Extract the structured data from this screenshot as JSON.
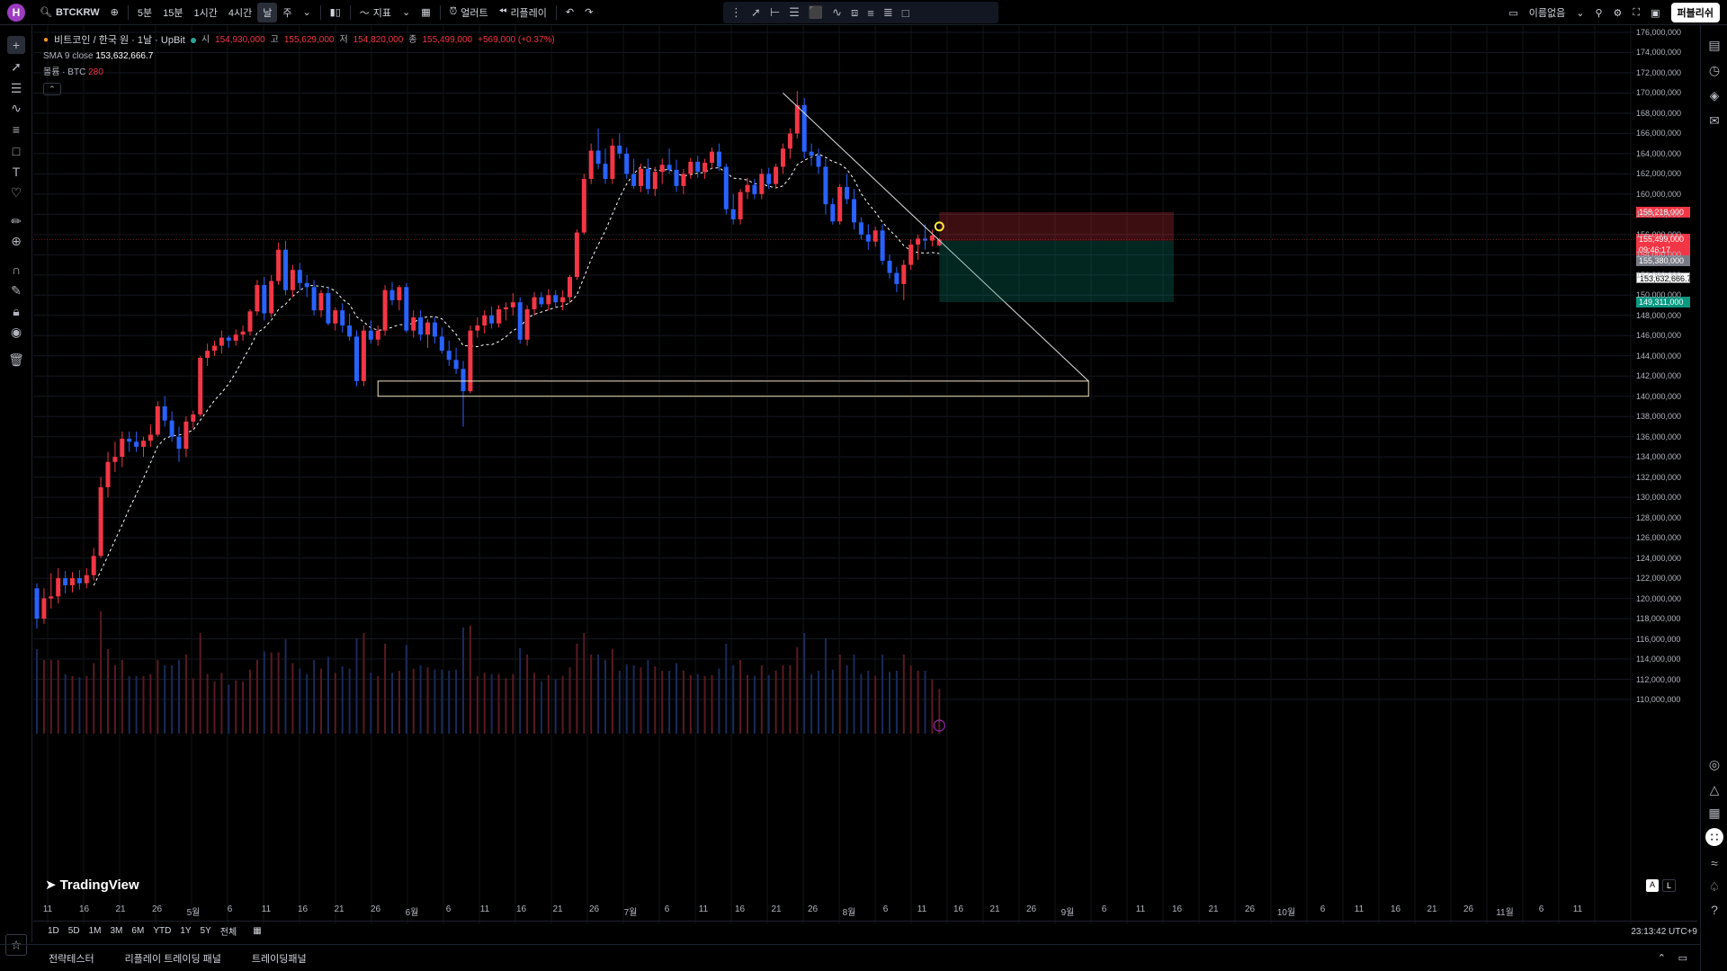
{
  "header": {
    "logo_letter": "H",
    "symbol": "BTCKRW",
    "intervals": [
      "5분",
      "15분",
      "1시간",
      "4시간",
      "날",
      "주"
    ],
    "active_interval": "날",
    "indicators_label": "지표",
    "alert_label": "얼러트",
    "replay_label": "리플레이",
    "layout_name": "이름없음",
    "publish_label": "퍼블리쉬"
  },
  "legend": {
    "title": "비트코인 / 한국 원 · 1날 · UpBit",
    "open_label": "시",
    "open": "154,930,000",
    "high_label": "고",
    "high": "155,629,000",
    "low_label": "저",
    "low": "154,820,000",
    "close_label": "종",
    "close": "155,499,000",
    "change": "+569,000 (+0.37%)",
    "sma_label": "SMA 9 close",
    "sma_value": "153,632,666.7",
    "volume_label": "볼륨 · BTC",
    "volume_value": "280"
  },
  "price_axis": {
    "ticks": [
      "176,000,000",
      "174,000,000",
      "172,000,000",
      "170,000,000",
      "168,000,000",
      "166,000,000",
      "164,000,000",
      "162,000,000",
      "160,000,000",
      "158,000,000",
      "156,000,000",
      "154,000,000",
      "152,000,000",
      "150,000,000",
      "148,000,000",
      "146,000,000",
      "144,000,000",
      "142,000,000",
      "140,000,000",
      "138,000,000",
      "136,000,000",
      "134,000,000",
      "132,000,000",
      "130,000,000",
      "128,000,000",
      "126,000,000",
      "124,000,000",
      "122,000,000",
      "120,000,000",
      "118,000,000",
      "116,000,000",
      "114,000,000",
      "112,000,000",
      "110,000,000"
    ],
    "labels": {
      "stop": "158,218,000",
      "last": "155,499,000",
      "countdown": "09:46:17",
      "entry": "155,380,000",
      "sma": "153,632,666.7",
      "target": "149,311,000"
    }
  },
  "time_axis": {
    "labels": [
      "11",
      "16",
      "21",
      "26",
      "5월",
      "6",
      "11",
      "16",
      "21",
      "26",
      "6월",
      "6",
      "11",
      "16",
      "21",
      "26",
      "7월",
      "6",
      "11",
      "16",
      "21",
      "26",
      "8월",
      "6",
      "11",
      "16",
      "21",
      "26",
      "9월",
      "6",
      "11",
      "16",
      "21",
      "26",
      "10월",
      "6",
      "11",
      "16",
      "21",
      "26",
      "11월",
      "6",
      "11"
    ]
  },
  "range_bar": {
    "ranges": [
      "1D",
      "5D",
      "1M",
      "3M",
      "6M",
      "YTD",
      "1Y",
      "5Y",
      "전체"
    ],
    "clock": "23:13:42 UTC+9"
  },
  "bottom_panel": {
    "tabs": [
      "전략테스터",
      "리플레이 트레이딩 패널",
      "트레이딩패널"
    ]
  },
  "watermark": "TradingView",
  "scale_buttons": [
    "A",
    "L"
  ],
  "colors": {
    "up": "#f23645",
    "down": "#2962ff",
    "sma": "#ffffff",
    "stop_zone": "rgba(242,54,69,0.25)",
    "target_zone": "rgba(8,153,129,0.25)"
  },
  "chart_data": {
    "type": "candlestick",
    "interval": "1D",
    "price_range": [
      109000000,
      177000000
    ],
    "candles_ohlc": [
      [
        121000000,
        121500000,
        117000000,
        118000000
      ],
      [
        118000000,
        121000000,
        117500000,
        120000000
      ],
      [
        120000000,
        122500000,
        119000000,
        120200000
      ],
      [
        120200000,
        123000000,
        119500000,
        122000000
      ],
      [
        122000000,
        122700000,
        120500000,
        121300000
      ],
      [
        121300000,
        122600000,
        120600000,
        122000000
      ],
      [
        122000000,
        122800000,
        120900000,
        121500000
      ],
      [
        121500000,
        123000000,
        121000000,
        122300000
      ],
      [
        122300000,
        125000000,
        121800000,
        124200000
      ],
      [
        124200000,
        132000000,
        124000000,
        131000000
      ],
      [
        131000000,
        134500000,
        130000000,
        133500000
      ],
      [
        133500000,
        135500000,
        132500000,
        134000000
      ],
      [
        134000000,
        136500000,
        133000000,
        135800000
      ],
      [
        135800000,
        136500000,
        134500000,
        135500000
      ],
      [
        135500000,
        136500000,
        134500000,
        135000000
      ],
      [
        135000000,
        136000000,
        134000000,
        135600000
      ],
      [
        135600000,
        137200000,
        135000000,
        136200000
      ],
      [
        136200000,
        139500000,
        136000000,
        139000000
      ],
      [
        139000000,
        140000000,
        137000000,
        137600000
      ],
      [
        137600000,
        138500000,
        135500000,
        136000000
      ],
      [
        136000000,
        137000000,
        133500000,
        134800000
      ],
      [
        134800000,
        138000000,
        134000000,
        137500000
      ],
      [
        137500000,
        138600000,
        136800000,
        138200000
      ],
      [
        138200000,
        144000000,
        138000000,
        143800000
      ],
      [
        143800000,
        145200000,
        143000000,
        144500000
      ],
      [
        144500000,
        145500000,
        144000000,
        145000000
      ],
      [
        145000000,
        146500000,
        144200000,
        145800000
      ],
      [
        145800000,
        146000000,
        144800000,
        145500000
      ],
      [
        145500000,
        146600000,
        145000000,
        146100000
      ],
      [
        146100000,
        147000000,
        145500000,
        146400000
      ],
      [
        146400000,
        148600000,
        146000000,
        148400000
      ],
      [
        148400000,
        151500000,
        148000000,
        151000000
      ],
      [
        151000000,
        151800000,
        147500000,
        148200000
      ],
      [
        148200000,
        152000000,
        147800000,
        151400000
      ],
      [
        151400000,
        155200000,
        151000000,
        154500000
      ],
      [
        154500000,
        155400000,
        150000000,
        150500000
      ],
      [
        150500000,
        153000000,
        149800000,
        152500000
      ],
      [
        152500000,
        153200000,
        150500000,
        151200000
      ],
      [
        151200000,
        152000000,
        149800000,
        150800000
      ],
      [
        150800000,
        151500000,
        148000000,
        148500000
      ],
      [
        148500000,
        150500000,
        147800000,
        150200000
      ],
      [
        150200000,
        150800000,
        147000000,
        147200000
      ],
      [
        147200000,
        148800000,
        146500000,
        148500000
      ],
      [
        148500000,
        149200000,
        146300000,
        147000000
      ],
      [
        147000000,
        148200000,
        145500000,
        145900000
      ],
      [
        145900000,
        146500000,
        141000000,
        141500000
      ],
      [
        141500000,
        147000000,
        141000000,
        146500000
      ],
      [
        146500000,
        147500000,
        145200000,
        145600000
      ],
      [
        145600000,
        147000000,
        145000000,
        146500000
      ],
      [
        146500000,
        151000000,
        146000000,
        150500000
      ],
      [
        150500000,
        151300000,
        149000000,
        149500000
      ],
      [
        149500000,
        151000000,
        148500000,
        150800000
      ],
      [
        150800000,
        151200000,
        146300000,
        146500000
      ],
      [
        146500000,
        148500000,
        145800000,
        147800000
      ],
      [
        147800000,
        148500000,
        145500000,
        146100000
      ],
      [
        146100000,
        147600000,
        144800000,
        147300000
      ],
      [
        147300000,
        147800000,
        145200000,
        145900000
      ],
      [
        145900000,
        146800000,
        144200000,
        144500000
      ],
      [
        144500000,
        145500000,
        143000000,
        143600000
      ],
      [
        143600000,
        144800000,
        142200000,
        142700000
      ],
      [
        142700000,
        143500000,
        137000000,
        140500000
      ],
      [
        140500000,
        147000000,
        140300000,
        146500000
      ],
      [
        146500000,
        147800000,
        145800000,
        147000000
      ],
      [
        147000000,
        148500000,
        146200000,
        148000000
      ],
      [
        148000000,
        148900000,
        146700000,
        147200000
      ],
      [
        147200000,
        149000000,
        146800000,
        148600000
      ],
      [
        148600000,
        149300000,
        147500000,
        148800000
      ],
      [
        148800000,
        150200000,
        148000000,
        149300000
      ],
      [
        149300000,
        149800000,
        145200000,
        145600000
      ],
      [
        145600000,
        149000000,
        145000000,
        148600000
      ],
      [
        148600000,
        150300000,
        148000000,
        149800000
      ],
      [
        149800000,
        150300000,
        148800000,
        149100000
      ],
      [
        149100000,
        150600000,
        148500000,
        150000000
      ],
      [
        150000000,
        150500000,
        148800000,
        149300000
      ],
      [
        149300000,
        150500000,
        148500000,
        149800000
      ],
      [
        149800000,
        152000000,
        149200000,
        151800000
      ],
      [
        151800000,
        156500000,
        151500000,
        156200000
      ],
      [
        156200000,
        162000000,
        156000000,
        161500000
      ],
      [
        161500000,
        165000000,
        161000000,
        164300000
      ],
      [
        164300000,
        166500000,
        162500000,
        163000000
      ],
      [
        163000000,
        164500000,
        161000000,
        161500000
      ],
      [
        161500000,
        165500000,
        161000000,
        164800000
      ],
      [
        164800000,
        166000000,
        163500000,
        164000000
      ],
      [
        164000000,
        164600000,
        161500000,
        162000000
      ],
      [
        162000000,
        163500000,
        160500000,
        160800000
      ],
      [
        160800000,
        163000000,
        160200000,
        162500000
      ],
      [
        162500000,
        163500000,
        160000000,
        160500000
      ],
      [
        160500000,
        162700000,
        159800000,
        162200000
      ],
      [
        162200000,
        163500000,
        161000000,
        162900000
      ],
      [
        162900000,
        164500000,
        162000000,
        162400000
      ],
      [
        162400000,
        163400000,
        160200000,
        160800000
      ],
      [
        160800000,
        162500000,
        160000000,
        162000000
      ],
      [
        162000000,
        163600000,
        161500000,
        163200000
      ],
      [
        163200000,
        163800000,
        161600000,
        162200000
      ],
      [
        162200000,
        163500000,
        161500000,
        163100000
      ],
      [
        163100000,
        164600000,
        162500000,
        164200000
      ],
      [
        164200000,
        165000000,
        162300000,
        162700000
      ],
      [
        162700000,
        163000000,
        158000000,
        158500000
      ],
      [
        158500000,
        160000000,
        157000000,
        157500000
      ],
      [
        157500000,
        160500000,
        157000000,
        160200000
      ],
      [
        160200000,
        161600000,
        159500000,
        160900000
      ],
      [
        160900000,
        161500000,
        159500000,
        160000000
      ],
      [
        160000000,
        162500000,
        159500000,
        162000000
      ],
      [
        162000000,
        162600000,
        160500000,
        161000000
      ],
      [
        161000000,
        163000000,
        160500000,
        162700000
      ],
      [
        162700000,
        165000000,
        162000000,
        164500000
      ],
      [
        164500000,
        166500000,
        163500000,
        166000000
      ],
      [
        166000000,
        170200000,
        165500000,
        168800000
      ],
      [
        168800000,
        169500000,
        163500000,
        164200000
      ],
      [
        164200000,
        165000000,
        162800000,
        163800000
      ],
      [
        163800000,
        164500000,
        162000000,
        162700000
      ],
      [
        162700000,
        163500000,
        158000000,
        159000000
      ],
      [
        159000000,
        159600000,
        157000000,
        157300000
      ],
      [
        157300000,
        161000000,
        157000000,
        160700000
      ],
      [
        160700000,
        162000000,
        159000000,
        159500000
      ],
      [
        159500000,
        160500000,
        156500000,
        157200000
      ],
      [
        157200000,
        157700000,
        155500000,
        156000000
      ],
      [
        156000000,
        157000000,
        154500000,
        155300000
      ],
      [
        155300000,
        156800000,
        154800000,
        156400000
      ],
      [
        156400000,
        157000000,
        153000000,
        153400000
      ],
      [
        153400000,
        154000000,
        151600000,
        152200000
      ],
      [
        152200000,
        152800000,
        150300000,
        151100000
      ],
      [
        151100000,
        153500000,
        149500000,
        153000000
      ],
      [
        153000000,
        155500000,
        152500000,
        155000000
      ],
      [
        155000000,
        156000000,
        153500000,
        155600000
      ],
      [
        155600000,
        157000000,
        154500000,
        155400000
      ],
      [
        155400000,
        156500000,
        154800000,
        155900000
      ],
      [
        154930000,
        155629000,
        154820000,
        155499000
      ]
    ],
    "sma_period": 9,
    "sma_last": 153632666.7,
    "annotations": {
      "trendline": [
        [
          170000000,
          "2025-08-14"
        ],
        [
          142000000,
          "2025-10-05"
        ]
      ],
      "support_box": [
        140000000,
        141500000
      ],
      "short_position": {
        "entry": 155380000,
        "stop": 158218000,
        "target": 149311000
      }
    }
  }
}
